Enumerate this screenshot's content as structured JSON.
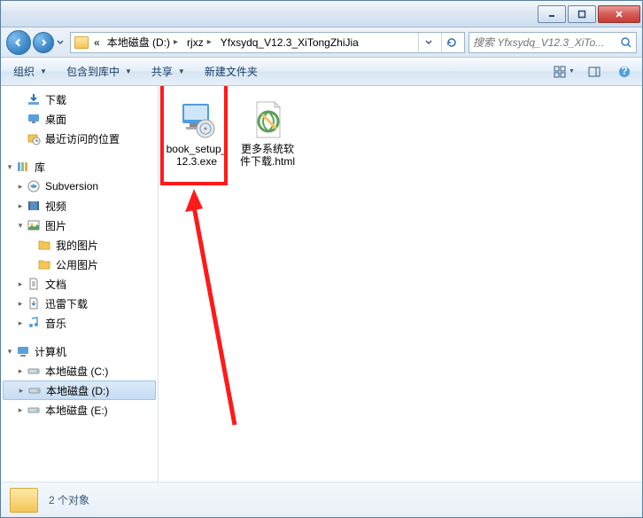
{
  "breadcrumb": {
    "prefix": "«",
    "items": [
      "本地磁盘 (D:)",
      "rjxz",
      "Yfxsydq_V12.3_XiTongZhiJia"
    ]
  },
  "search": {
    "placeholder": "搜索 Yfxsydq_V12.3_XiTo..."
  },
  "toolbar": {
    "organize": "组织",
    "include": "包含到库中",
    "share": "共享",
    "newfolder": "新建文件夹"
  },
  "tree": {
    "downloads": "下载",
    "desktop": "桌面",
    "recent": "最近访问的位置",
    "libraries": "库",
    "subversion": "Subversion",
    "videos": "视频",
    "pictures": "图片",
    "my_pictures": "我的图片",
    "public_pictures": "公用图片",
    "documents": "文档",
    "xunlei": "迅雷下载",
    "music": "音乐",
    "computer": "计算机",
    "drive_c": "本地磁盘 (C:)",
    "drive_d": "本地磁盘 (D:)",
    "drive_e": "本地磁盘 (E:)"
  },
  "files": {
    "f1": "book_setup_12.3.exe",
    "f2": "更多系统软件下载.html"
  },
  "status": {
    "count_label": "2 个对象"
  }
}
